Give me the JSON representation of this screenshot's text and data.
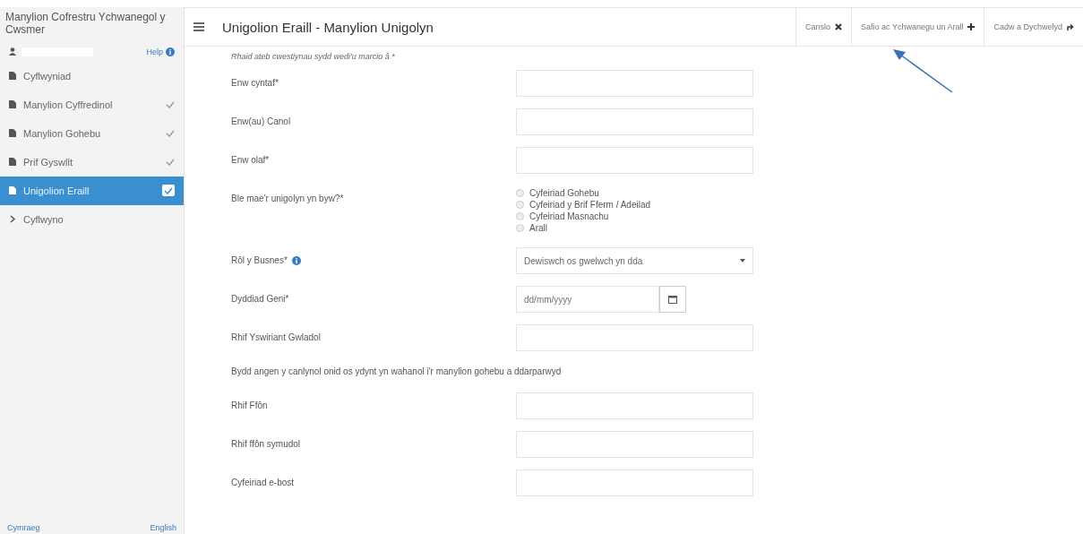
{
  "sidebar": {
    "title": "Manylion Cofrestru Ychwanegol y Cwsmer",
    "help": "Help",
    "items": [
      {
        "label": "Cyflwyniad",
        "kind": "page",
        "done": false,
        "selected": false
      },
      {
        "label": "Manylion Cyffredinol",
        "kind": "page",
        "done": true,
        "selected": false
      },
      {
        "label": "Manylion Gohebu",
        "kind": "page",
        "done": true,
        "selected": false
      },
      {
        "label": "Prif Gyswllt",
        "kind": "page",
        "done": true,
        "selected": false
      },
      {
        "label": "Unigolion Eraill",
        "kind": "page",
        "done": true,
        "selected": true
      },
      {
        "label": "Cyflwyno",
        "kind": "submit",
        "done": false,
        "selected": false
      }
    ],
    "footer": [
      "Cymraeg",
      "English"
    ]
  },
  "header": {
    "title": "Unigolion Eraill - Manylion Unigolyn",
    "buttons": [
      {
        "label": "Canslo",
        "kind": "cancel"
      },
      {
        "label": "Safio ac Ychwanegu un Arall",
        "kind": "add"
      },
      {
        "label": "Cadw a Dychwelyd",
        "kind": "return"
      }
    ]
  },
  "form": {
    "note": "Rhaid ateb cwestiynau sydd wedi'u marcio â *",
    "rows": [
      {
        "kind": "text",
        "label": "Enw cyntaf*"
      },
      {
        "kind": "text",
        "label": "Enw(au) Canol"
      },
      {
        "kind": "text",
        "label": "Enw olaf*"
      },
      {
        "kind": "radio",
        "label": "Ble mae'r unigolyn yn byw?*",
        "options": [
          {
            "label": "Cyfeiriad Gohebu",
            "selected": false
          },
          {
            "label": "Cyfeiriad y Brif Fferm / Adeilad",
            "selected": false
          },
          {
            "label": "Cyfeiriad Masnachu",
            "selected": false
          },
          {
            "label": "Arall",
            "selected": false
          }
        ]
      },
      {
        "kind": "select",
        "label": "Rôl y Busnes*",
        "info": true,
        "placeholder": "Dewiswch os gwelwch yn dda"
      },
      {
        "kind": "date",
        "label": "Dyddiad Geni*",
        "placeholder": "dd/mm/yyyy"
      },
      {
        "kind": "text",
        "label": "Rhif Yswiriant Gwladol"
      },
      {
        "kind": "note",
        "label": "Bydd angen y canlynol onid os ydynt yn wahanol i'r manylion gohebu a ddarparwyd"
      },
      {
        "kind": "text",
        "label": "Rhif Ffôn"
      },
      {
        "kind": "text",
        "label": "Rhif ffôn symudol"
      },
      {
        "kind": "text",
        "label": "Cyfeiriad e-bost"
      }
    ]
  }
}
